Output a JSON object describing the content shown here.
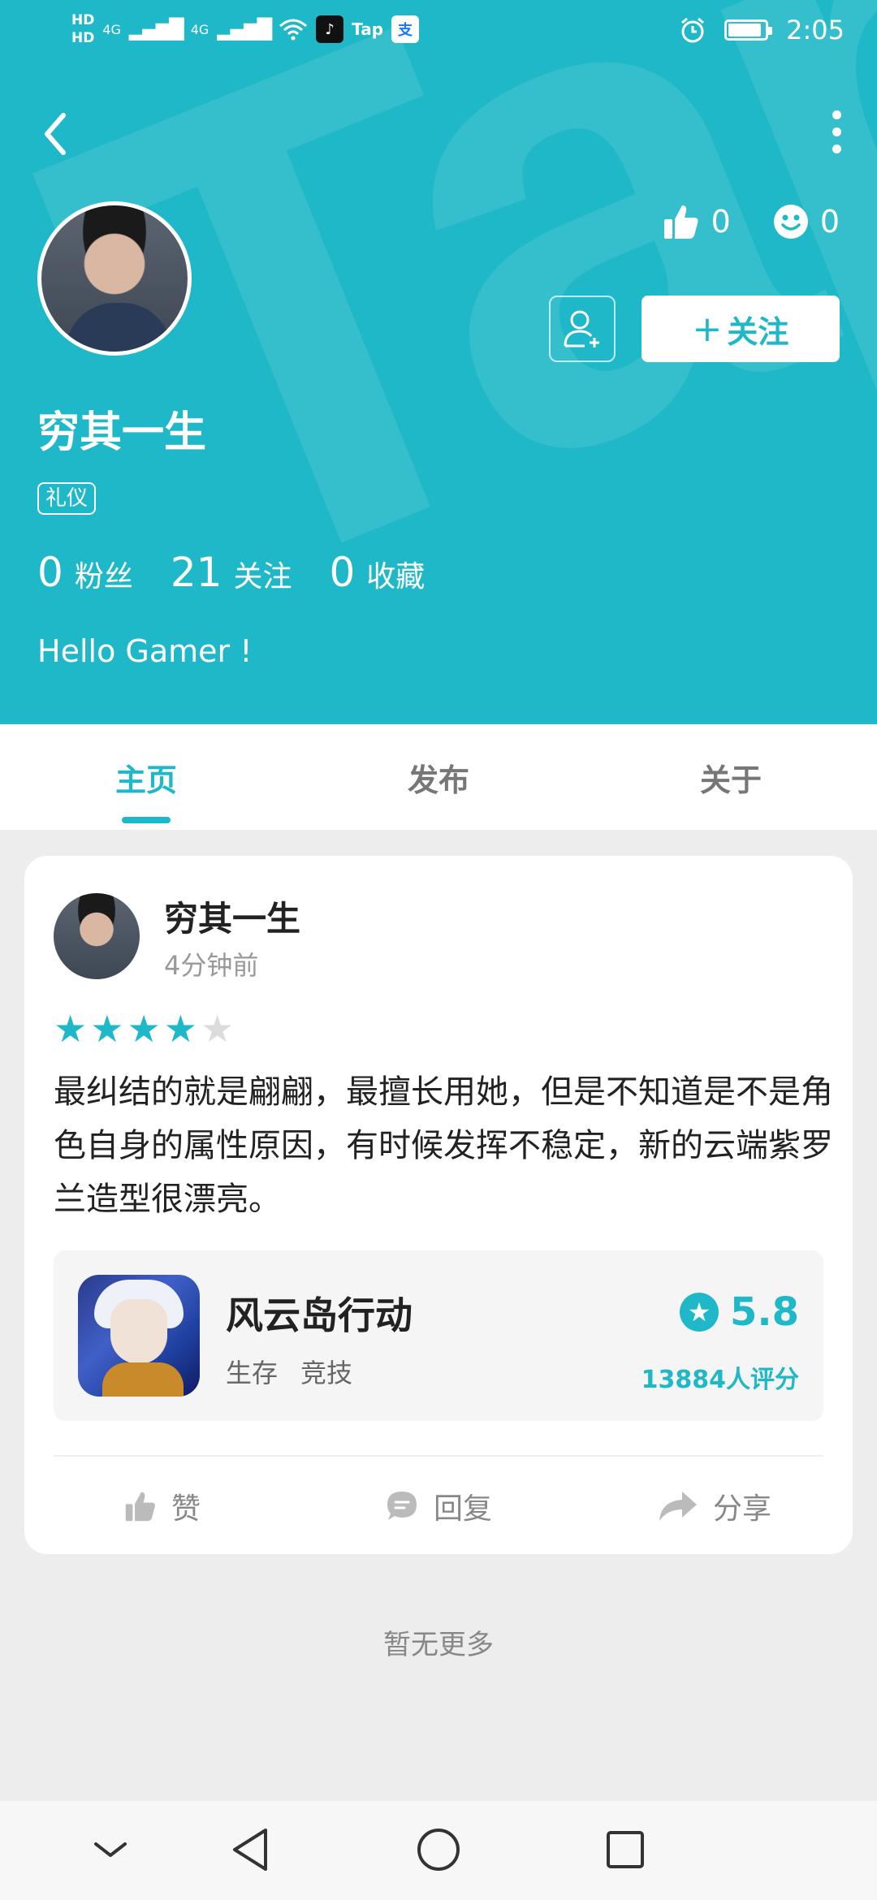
{
  "status_bar": {
    "hd1": "HD",
    "hd2": "HD",
    "net1": "4G",
    "net2": "4G",
    "tap": "Tap",
    "alipay": "支",
    "time": "2:05"
  },
  "profile": {
    "name": "穷其一生",
    "badge": "礼仪",
    "likes_count": "0",
    "smiles_count": "0",
    "follow_label": "关注",
    "follow_plus": "+",
    "stats": [
      {
        "value": "0",
        "label": "粉丝"
      },
      {
        "value": "21",
        "label": "关注"
      },
      {
        "value": "0",
        "label": "收藏"
      }
    ],
    "bio": "Hello Gamer !"
  },
  "tabs": [
    {
      "label": "主页",
      "active": true
    },
    {
      "label": "发布",
      "active": false
    },
    {
      "label": "关于",
      "active": false
    }
  ],
  "review": {
    "author": "穷其一生",
    "time": "4分钟前",
    "stars": 4,
    "stars_max": 5,
    "text": "最纠结的就是翩翩，最擅长用她，但是不知道是不是角色自身的属性原因，有时候发挥不稳定，新的云端紫罗兰造型很漂亮。",
    "game": {
      "name": "风云岛行动",
      "tags": [
        "生存",
        "竞技"
      ],
      "score": "5.8",
      "rating_count": "13884人评分"
    },
    "actions": {
      "like": "赞",
      "reply": "回复",
      "share": "分享"
    }
  },
  "footer_text": "暂无更多",
  "colors": {
    "accent": "#1fb8c8",
    "background": "#ededed"
  }
}
